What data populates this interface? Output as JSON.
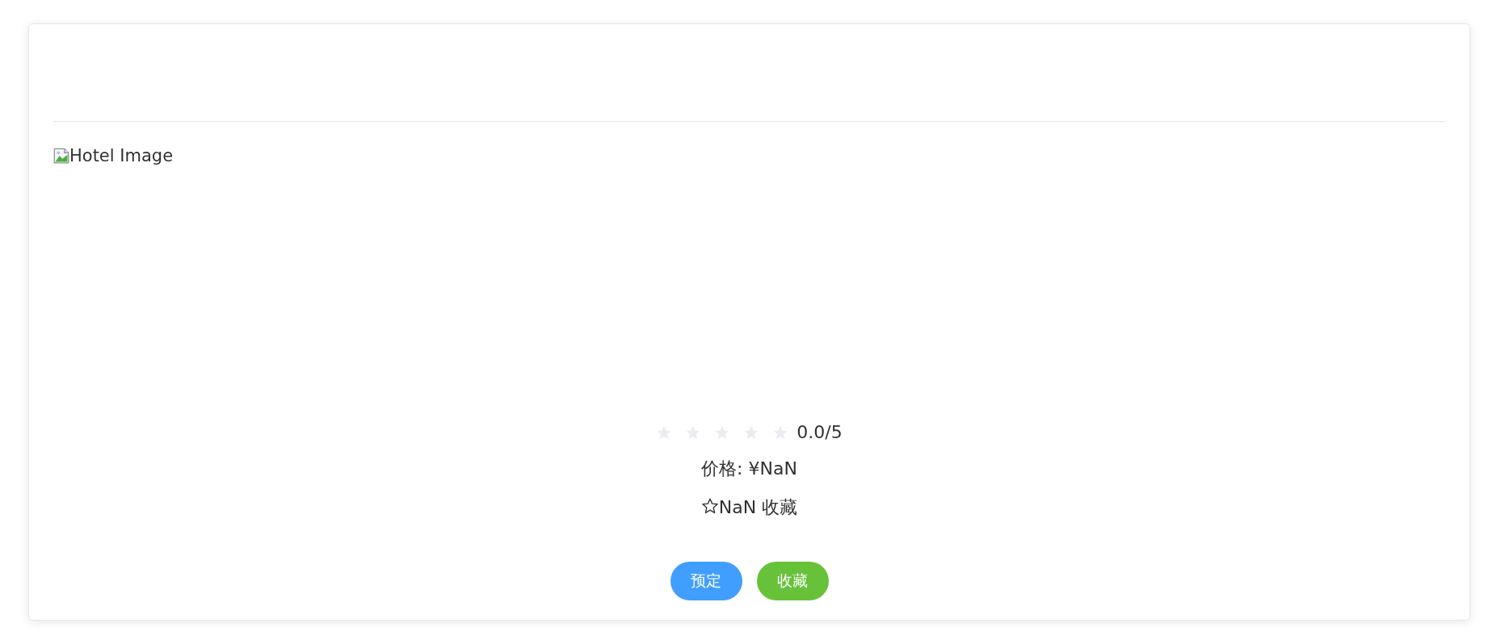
{
  "card": {
    "image": {
      "alt": "Hotel Image"
    },
    "rating": {
      "stars": 0,
      "reading": "0.0/5"
    },
    "price": "价格: ¥NaN",
    "favorites": "NaN 收藏",
    "buttons": [
      {
        "label": "预定",
        "kind": "primary"
      },
      {
        "label": "收藏",
        "kind": "success"
      }
    ]
  }
}
